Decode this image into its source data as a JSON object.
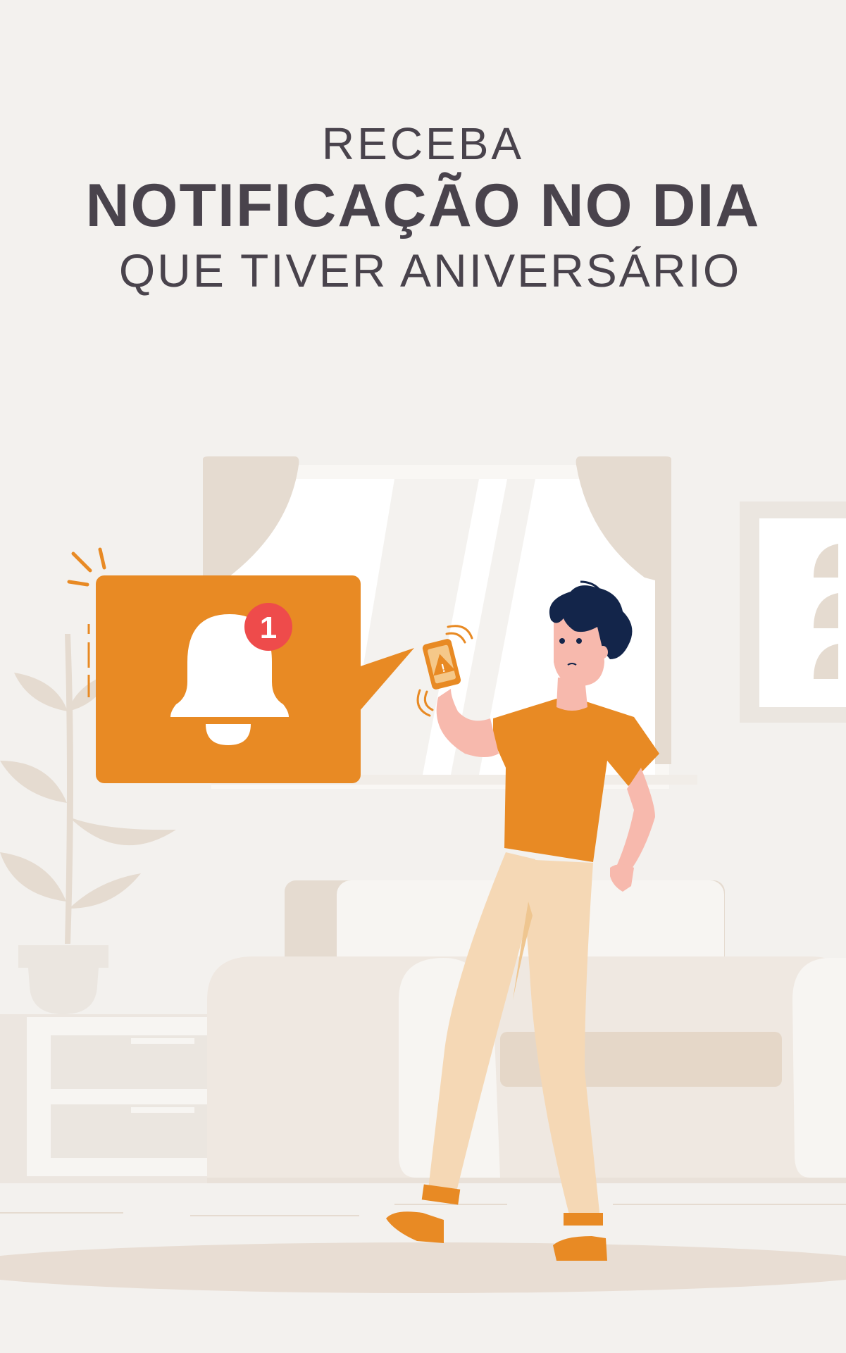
{
  "headline": {
    "line1": "RECEBA",
    "line2": "NOTIFICAÇÃO NO DIA",
    "line3": "QUE TIVER ANIVERSÁRIO"
  },
  "notification": {
    "badge_count": "1",
    "alert_symbol": "!"
  },
  "colors": {
    "background": "#f3f1ee",
    "accent_orange": "#e88a24",
    "badge_red": "#ee4b4b",
    "text_dark": "#49434c",
    "hair_navy": "#13254a",
    "pants_beige": "#f5d8b5",
    "skin": "#f7b9ad"
  },
  "icons": [
    "bell-icon",
    "warning-icon",
    "vibration-waves-icon"
  ]
}
